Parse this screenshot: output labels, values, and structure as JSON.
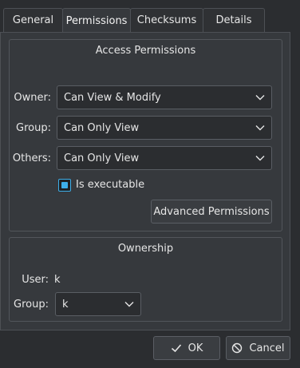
{
  "tabs": [
    "General",
    "Permissions",
    "Checksums",
    "Details"
  ],
  "access": {
    "title": "Access Permissions",
    "owner_label": "Owner:",
    "owner_value": "Can View & Modify",
    "group_label": "Group:",
    "group_value": "Can Only View",
    "others_label": "Others:",
    "others_value": "Can Only View",
    "executable_label": "Is executable",
    "executable_checked": true,
    "advanced_button": "Advanced Permissions"
  },
  "ownership": {
    "title": "Ownership",
    "user_label": "User:",
    "user_value": "k",
    "group_label": "Group:",
    "group_value": "k"
  },
  "footer": {
    "ok_label": "OK",
    "cancel_label": "Cancel"
  },
  "colors": {
    "accent": "#3daee9",
    "background": "#2b2d30",
    "panel": "#36393d"
  },
  "icons": {
    "dropdown": "chevron-down-icon",
    "ok": "check-icon",
    "cancel": "cancel-icon"
  }
}
